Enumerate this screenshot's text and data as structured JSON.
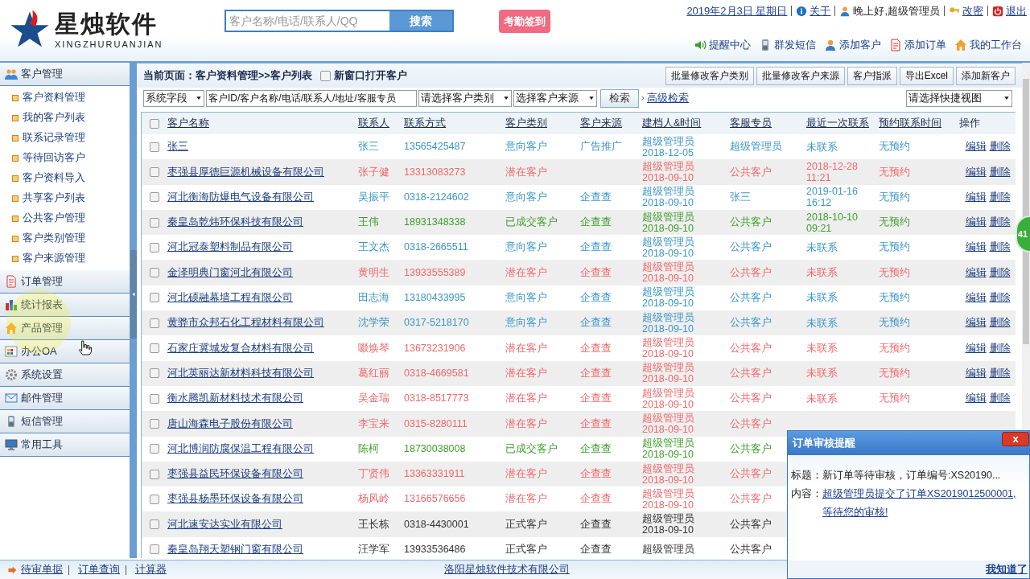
{
  "header": {
    "logo_text": "星烛软件",
    "logo_subtext": "XINGZHURUANJIAN",
    "search": {
      "placeholder": "客户名称/电话/联系人/QQ",
      "button": "搜索"
    },
    "checkin_button": "考勤签到",
    "top_links": [
      {
        "kind": "date",
        "label": "2019年2月3日 星期日"
      },
      {
        "kind": "info",
        "label": "关于"
      },
      {
        "kind": "user",
        "label": "晚上好,超级管理员"
      },
      {
        "kind": "key",
        "label": "改密"
      },
      {
        "kind": "power",
        "label": "退出"
      }
    ],
    "nav_links": [
      {
        "kind": "speaker",
        "label": "提醒中心"
      },
      {
        "kind": "phone",
        "label": "群发短信"
      },
      {
        "kind": "user",
        "label": "添加客户"
      },
      {
        "kind": "doc",
        "label": "添加订单"
      },
      {
        "kind": "home",
        "label": "我的工作台"
      }
    ]
  },
  "sidebar": {
    "groups": [
      {
        "label": "客户管理",
        "children": [
          {
            "label": "客户资料管理"
          },
          {
            "label": "我的客户列表"
          },
          {
            "label": "联系记录管理"
          },
          {
            "label": "等待回访客户"
          },
          {
            "label": "客户资料导入"
          },
          {
            "label": "共享客户列表"
          },
          {
            "label": "公共客户管理"
          },
          {
            "label": "客户类别管理"
          },
          {
            "label": "客户来源管理"
          }
        ]
      },
      {
        "label": "订单管理"
      },
      {
        "label": "统计报表"
      },
      {
        "label": "产品管理"
      },
      {
        "label": "办公OA"
      },
      {
        "label": "系统设置"
      },
      {
        "label": "邮件管理"
      },
      {
        "label": "短信管理"
      },
      {
        "label": "常用工具"
      }
    ]
  },
  "toolbar": {
    "breadcrumb": "当前页面：客户资料管理>>客户列表",
    "new_window": {
      "label": "新窗口打开客户",
      "checked": false
    },
    "buttons": [
      "批量修改客户类别",
      "批量修改客户来源",
      "客户指派",
      "导出Excel",
      "添加新客户"
    ]
  },
  "filters": {
    "field_select": "系统字段",
    "search": {
      "placeholder": "客户ID/客户名称/电话/联系人/地址/客服专员"
    },
    "category_select": "请选择客户类别",
    "source_select": "选择客户来源",
    "search_button": "检索",
    "advanced_link": "高级检索",
    "view_select": "请选择快捷视图"
  },
  "table": {
    "select_all_checked": false,
    "columns": [
      "客户名称",
      "联系人",
      "联系方式",
      "客户类别",
      "客户来源",
      "建档人&时间",
      "客服专员",
      "最近一次联系",
      "预约联系时间",
      "操作"
    ],
    "rows": [
      {
        "color": "#3b96c6",
        "checked": false,
        "name": "张三",
        "contact": "张三",
        "phone": "13565425487",
        "category": "意向客户",
        "source": "广告推广",
        "creator": "超级管理员",
        "created": "2018-12-05",
        "agent": "超级管理员",
        "last_contact": "未联系",
        "appointment": "无预约",
        "actions": [
          "编辑",
          "删除"
        ]
      },
      {
        "color": "#f0686b",
        "checked": false,
        "name": "枣强县厚德巨源机械设备有限公司",
        "contact": "张子健",
        "phone": "13313083273",
        "category": "潜在客户",
        "creator": "超级管理员",
        "created": "2018-09-10",
        "agent": "公共客户",
        "last_contact": "2018-12-28 11:21",
        "appointment": "无预约",
        "actions": [
          "编辑",
          "删除"
        ]
      },
      {
        "color": "#3b96c6",
        "checked": false,
        "name": "河北衡海防爆电气设备有限公司",
        "contact": "吴振平",
        "phone": "0318-2124602",
        "category": "意向客户",
        "source": "企查查",
        "creator": "超级管理员",
        "created": "2018-09-10",
        "agent": "张三",
        "last_contact": "2019-01-16 16:12",
        "appointment": "无预约",
        "actions": [
          "编辑",
          "删除"
        ]
      },
      {
        "color": "#3f9e2c",
        "checked": false,
        "name": "秦皇岛乾炜环保科技有限公司",
        "contact": "王伟",
        "phone": "18931348338",
        "category": "已成交客户",
        "source": "企查查",
        "creator": "超级管理员",
        "created": "2018-09-10",
        "agent": "公共客户",
        "last_contact": "2018-10-10 09:21",
        "appointment": "无预约",
        "actions": [
          "编辑",
          "删除"
        ]
      },
      {
        "color": "#3b96c6",
        "checked": false,
        "name": "河北冠泰塑料制品有限公司",
        "contact": "王文杰",
        "phone": "0318-2665511",
        "category": "意向客户",
        "source": "企查查",
        "creator": "超级管理员",
        "created": "2018-09-10",
        "agent": "公共客户",
        "last_contact": "未联系",
        "appointment": "无预约",
        "actions": [
          "编辑",
          "删除"
        ]
      },
      {
        "color": "#f0686b",
        "checked": false,
        "name": "金泽明典门窗河北有限公司",
        "contact": "黄明生",
        "phone": "13933555389",
        "category": "潜在客户",
        "source": "企查查",
        "creator": "超级管理员",
        "created": "2018-09-10",
        "agent": "公共客户",
        "last_contact": "未联系",
        "appointment": "无预约",
        "actions": [
          "编辑",
          "删除"
        ]
      },
      {
        "color": "#3b96c6",
        "checked": false,
        "name": "河北硕融幕墙工程有限公司",
        "contact": "田志海",
        "phone": "13180433995",
        "category": "意向客户",
        "source": "企查查",
        "creator": "超级管理员",
        "created": "2018-09-10",
        "agent": "公共客户",
        "last_contact": "未联系",
        "appointment": "无预约",
        "actions": [
          "编辑",
          "删除"
        ]
      },
      {
        "color": "#3b96c6",
        "checked": false,
        "name": "黄骅市众邦石化工程材料有限公司",
        "contact": "沈学荣",
        "phone": "0317-5218170",
        "category": "意向客户",
        "source": "企查查",
        "creator": "超级管理员",
        "created": "2018-09-10",
        "agent": "公共客户",
        "last_contact": "未联系",
        "appointment": "无预约",
        "actions": [
          "编辑",
          "删除"
        ]
      },
      {
        "color": "#f0686b",
        "checked": false,
        "name": "石家庄冀城发复合材料有限公司",
        "contact": "啜焕琴",
        "phone": "13673231906",
        "category": "潜在客户",
        "source": "企查查",
        "creator": "超级管理员",
        "created": "2018-09-10",
        "agent": "公共客户",
        "last_contact": "未联系",
        "appointment": "无预约",
        "actions": [
          "编辑",
          "删除"
        ]
      },
      {
        "color": "#f0686b",
        "checked": false,
        "name": "河北英丽达新材料科技有限公司",
        "contact": "葛红丽",
        "phone": "0318-4669581",
        "category": "潜在客户",
        "source": "企查查",
        "creator": "超级管理员",
        "created": "2018-09-10",
        "agent": "公共客户",
        "last_contact": "未联系",
        "appointment": "无预约",
        "actions": [
          "编辑",
          "删除"
        ]
      },
      {
        "color": "#f0686b",
        "checked": false,
        "name": "衡水腾凯新材料技术有限公司",
        "contact": "吴金瑞",
        "phone": "0318-8517773",
        "category": "潜在客户",
        "source": "企查查",
        "creator": "超级管理员",
        "created": "2018-09-10",
        "agent": "公共客户",
        "last_contact": "未联系",
        "appointment": "无预约",
        "actions": [
          "编辑",
          "删除"
        ]
      },
      {
        "color": "#f0686b",
        "checked": false,
        "name": "唐山海森电子股份有限公司",
        "contact": "李宝来",
        "phone": "0315-8280111",
        "category": "潜在客户",
        "source": "企查查",
        "creator": "超级管理员",
        "created": "2018-09-10",
        "agent": "公共客户"
      },
      {
        "color": "#3f9e2c",
        "checked": false,
        "name": "河北博润防腐保温工程有限公司",
        "contact": "陈柯",
        "phone": "18730038008",
        "category": "已成交客户",
        "source": "企查查",
        "creator": "超级管理员",
        "created": "2018-09-10",
        "agent": "公共客户"
      },
      {
        "color": "#f0686b",
        "checked": false,
        "name": "枣强县益民环保设备有限公司",
        "contact": "丁贤伟",
        "phone": "13363331911",
        "category": "潜在客户",
        "source": "企查查",
        "creator": "超级管理员",
        "created": "2018-09-10",
        "agent": "公共客户"
      },
      {
        "color": "#f0686b",
        "checked": false,
        "name": "枣强县杨墨环保设备有限公司",
        "contact": "杨风岭",
        "phone": "13166576656",
        "category": "潜在客户",
        "source": "企查查",
        "creator": "超级管理员",
        "created": "2018-09-10",
        "agent": "公共客户"
      },
      {
        "color": "#333333",
        "checked": false,
        "name": "河北速安达实业有限公司",
        "contact": "王长栋",
        "phone": "0318-4430001",
        "category": "正式客户",
        "source": "企查查",
        "creator": "超级管理员",
        "created": "2018-09-10",
        "agent": "公共客户"
      },
      {
        "color": "#333333",
        "checked": false,
        "name": "秦皇岛翔天塑钢门窗有限公司",
        "contact": "汪学军",
        "phone": "13933536486",
        "category": "正式客户",
        "source": "企查查",
        "creator": "超级管理员",
        "agent": "公共客户"
      }
    ]
  },
  "side_badge": "41",
  "popup": {
    "title": "订单审核提醒",
    "close": "x",
    "subject": "标题：新订单等待审核，订单编号:XS20190...",
    "content_label": "内容：",
    "content_link": "超级管理员提交了订单XS2019012500001,等待您的审核!",
    "dismiss": "我知道了"
  },
  "footer": {
    "links": [
      "待审单据",
      "订单查询",
      "计算器"
    ],
    "company": "洛阳星烛软件技术有限公司"
  }
}
